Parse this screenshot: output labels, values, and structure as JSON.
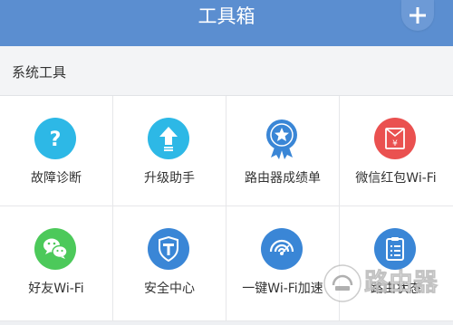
{
  "header": {
    "title": "工具箱",
    "add_icon": "plus-icon"
  },
  "section": {
    "label": "系统工具"
  },
  "tools": [
    {
      "label": "故障诊断",
      "icon": "question-icon",
      "color": "#2db8e6"
    },
    {
      "label": "升级助手",
      "icon": "upgrade-arrow-icon",
      "color": "#2db8e6"
    },
    {
      "label": "路由器成绩单",
      "icon": "medal-star-icon",
      "color": "#3a86d6"
    },
    {
      "label": "微信红包Wi-Fi",
      "icon": "red-envelope-icon",
      "color": "#ea5150"
    },
    {
      "label": "好友Wi-Fi",
      "icon": "wechat-icon",
      "color": "#4cc95a"
    },
    {
      "label": "安全中心",
      "icon": "shield-icon",
      "color": "#3a86d6"
    },
    {
      "label": "一键Wi-Fi加速",
      "icon": "wifi-speed-icon",
      "color": "#3a86d6"
    },
    {
      "label": "路由状态",
      "icon": "clipboard-status-icon",
      "color": "#3a86d6"
    }
  ],
  "watermark": {
    "text": "路由器",
    "icon": "watermark-logo-icon"
  }
}
